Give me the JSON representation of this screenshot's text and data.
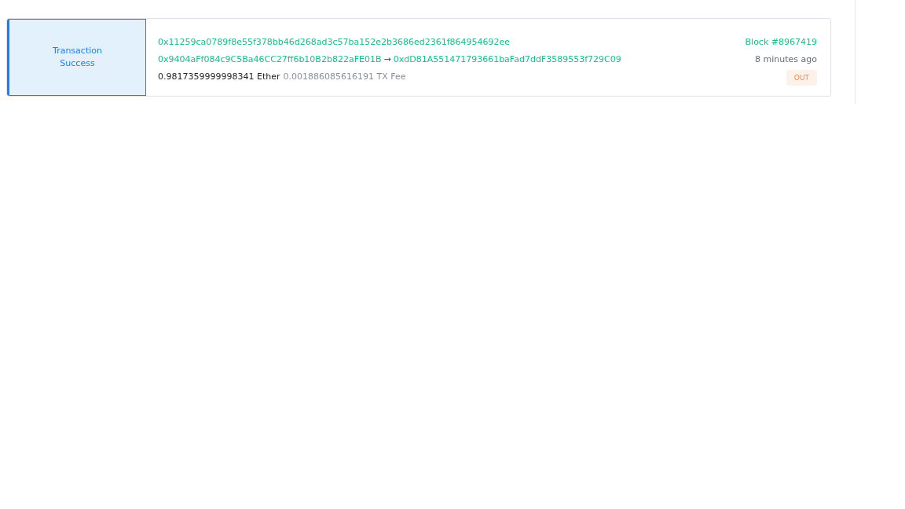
{
  "transaction": {
    "status": {
      "kind": "success",
      "lines": [
        "Transaction",
        "Success"
      ]
    },
    "hash": "0x11259ca0789f8e55f378bb46d268ad3c57ba152e2b3686ed2361f864954692ee",
    "from": "0x9404aFf084c9C5Ba46CC27ff6b10B2b822aFE01B",
    "arrow": "→",
    "to": "0xdD81A551471793661baFad7ddF3589553f729C09",
    "amount": "0.9817359999998341 Ether",
    "fee": "0.001886085616191 TX Fee",
    "block": "Block #8967419",
    "age": "8 minutes ago",
    "direction": {
      "kind": "out",
      "label": "OUT"
    }
  }
}
